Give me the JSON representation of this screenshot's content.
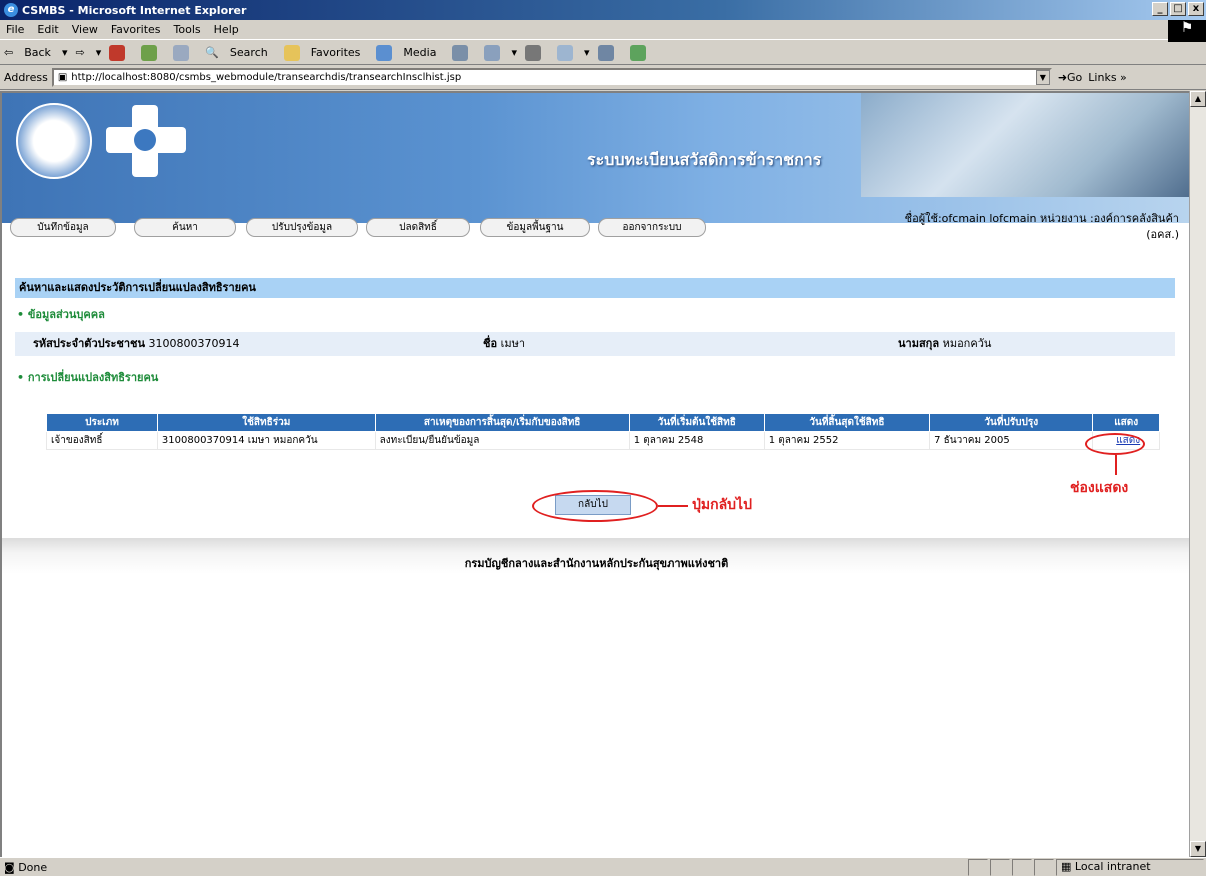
{
  "window": {
    "title": "CSMBS - Microsoft Internet Explorer",
    "buttons": [
      "_",
      "□",
      "x"
    ]
  },
  "menubar": [
    "File",
    "Edit",
    "View",
    "Favorites",
    "Tools",
    "Help"
  ],
  "toolbar": {
    "back": "Back",
    "search": "Search",
    "favorites": "Favorites",
    "media": "Media"
  },
  "address": {
    "label": "Address",
    "url": "http://localhost:8080/csmbs_webmodule/transearchdis/transearchInsclhist.jsp",
    "go": "Go",
    "links": "Links"
  },
  "header": {
    "system_title": "ระบบทะเบียนสวัสดิการข้าราชการ",
    "nav": [
      "บันทึกข้อมูล",
      "ค้นหา",
      "ปรับปรุงข้อมูล",
      "ปลดสิทธิ์",
      "ข้อมูลพื้นฐาน",
      "ออกจากระบบ"
    ],
    "user_line1": "ชื่อผู้ใช้:ofcmain lofcmain  หน่วยงาน :องค์การคลังสินค้า",
    "user_line2": "(อคส.)"
  },
  "page": {
    "heading": "ค้นหาและแสดงประวัติการเปลี่ยนแปลงสิทธิรายคน",
    "personal_section": "• ข้อมูลส่วนบุคคล",
    "id_label": "รหัสประจำตัวประชาชน",
    "id_value": "3100800370914",
    "name_label": "ชื่อ",
    "name_value": "เมษา",
    "surname_label": "นามสกุล",
    "surname_value": "หมอกควัน",
    "changes_section": "• การเปลี่ยนแปลงสิทธิรายคน"
  },
  "table": {
    "headers": [
      "ประเภท",
      "ใช้สิทธิร่วม",
      "สาเหตุของการสิ้นสุด/เริ่มกับของสิทธิ",
      "วันที่เริ่มต้นใช้สิทธิ",
      "วันที่สิ้นสุดใช้สิทธิ",
      "วันที่ปรับปรุง",
      "แสดง"
    ],
    "rows": [
      {
        "type": "เจ้าของสิทธิ์",
        "joint": "3100800370914 เมษา หมอกควัน",
        "reason": "ลงทะเบียน/ยืนยันข้อมูล",
        "start": "1 ตุลาคม 2548",
        "end": "1 ตุลาคม 2552",
        "updated": "7 ธันวาคม 2005",
        "show": "แสดง"
      }
    ]
  },
  "back_button": "กลับไป",
  "annotations": {
    "back": "ปุ่มกลับไป",
    "show": "ช่องแสดง"
  },
  "footer": "กรมบัญชีกลางและสำนักงานหลักประกันสุขภาพแห่งชาติ",
  "status": {
    "text": "Done",
    "zone": "Local intranet"
  }
}
